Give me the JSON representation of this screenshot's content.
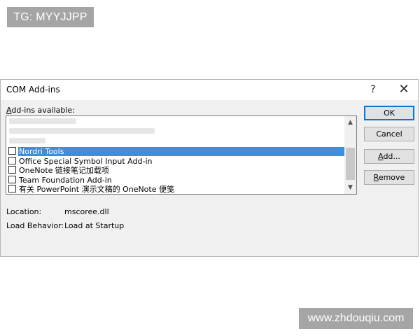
{
  "overlay": {
    "tg_label": "TG: MYYJJPP",
    "watermark": "www.zhdouqiu.com"
  },
  "dialog": {
    "title": "COM Add-ins",
    "help_symbol": "?",
    "close_symbol": "✕",
    "available_label_prefix": "A",
    "available_label_rest": "dd-ins available:",
    "addins": [
      {
        "label": "Nordri Tools",
        "checked": false,
        "selected": true
      },
      {
        "label": "Office Special Symbol Input Add-in",
        "checked": false,
        "selected": false
      },
      {
        "label": "OneNote 链接笔记加载项",
        "checked": false,
        "selected": false
      },
      {
        "label": "Team Foundation Add-in",
        "checked": false,
        "selected": false
      },
      {
        "label": "有关 PowerPoint 演示文稿的 OneNote 便笺",
        "checked": false,
        "selected": false
      }
    ],
    "scroll_up_icon": "▲",
    "scroll_down_icon": "▼",
    "buttons": {
      "ok": "OK",
      "cancel": "Cancel",
      "add_prefix": "A",
      "add_rest": "dd...",
      "remove_prefix": "R",
      "remove_rest": "emove"
    },
    "location_label": "Location:",
    "location_value": "mscoree.dll",
    "load_behavior_label": "Load Behavior:",
    "load_behavior_value": "Load at Startup"
  },
  "colors": {
    "selection": "#3d8ede",
    "ok_border": "#0078d7",
    "dialog_bg": "#f0f0f0"
  }
}
